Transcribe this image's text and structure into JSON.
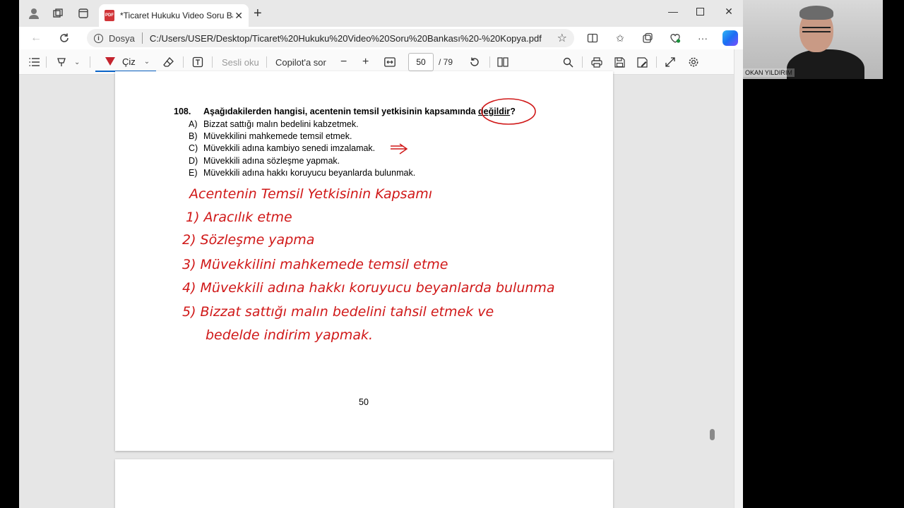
{
  "tab": {
    "title": "*Ticaret Hukuku Video Soru Bank",
    "pdf_badge": "PDF"
  },
  "address": {
    "scheme_label": "Dosya",
    "url": "C:/Users/USER/Desktop/Ticaret%20Hukuku%20Video%20Soru%20Bankası%20-%20Kopya.pdf"
  },
  "pdf_toolbar": {
    "draw_label": "Çiz",
    "read_aloud_label": "Sesli oku",
    "copilot_label": "Copilot'a sor",
    "current_page": "50",
    "total_pages": "/ 79"
  },
  "document": {
    "question_number": "108.",
    "question_text_before": "Aşağıdakilerden hangisi, acentenin temsil yetkisinin kapsamında ",
    "question_text_emph": "değildir",
    "question_text_after": "?",
    "options": [
      {
        "letter": "A)",
        "text": "Bizzat sattığı malın bedelini kabzetmek."
      },
      {
        "letter": "B)",
        "text": "Müvekkilini mahkemede temsil etmek."
      },
      {
        "letter": "C)",
        "text": "Müvekkili adına kambiyo senedi imzalamak."
      },
      {
        "letter": "D)",
        "text": "Müvekkili adına sözleşme yapmak."
      },
      {
        "letter": "E)",
        "text": "Müvekkili adına hakkı koruyucu beyanlarda bulunmak."
      }
    ],
    "page_number": "50",
    "handwriting": {
      "title": "Acentenin Temsil Yetkisinin Kapsamı",
      "items": [
        "1) Aracılık etme",
        "2) Sözleşme yapma",
        "3) Müvekkilini mahkemede temsil etme",
        "4) Müvekkili adına hakkı koruyucu beyanlarda bulunma",
        "5) Bizzat sattığı malın bedelini tahsil etmek ve",
        "bedelde indirim yapmak."
      ]
    }
  },
  "webcam": {
    "name": "OKAN YILDIRIM"
  },
  "colors": {
    "ink": "#d01818",
    "accent": "#0a64c8"
  }
}
